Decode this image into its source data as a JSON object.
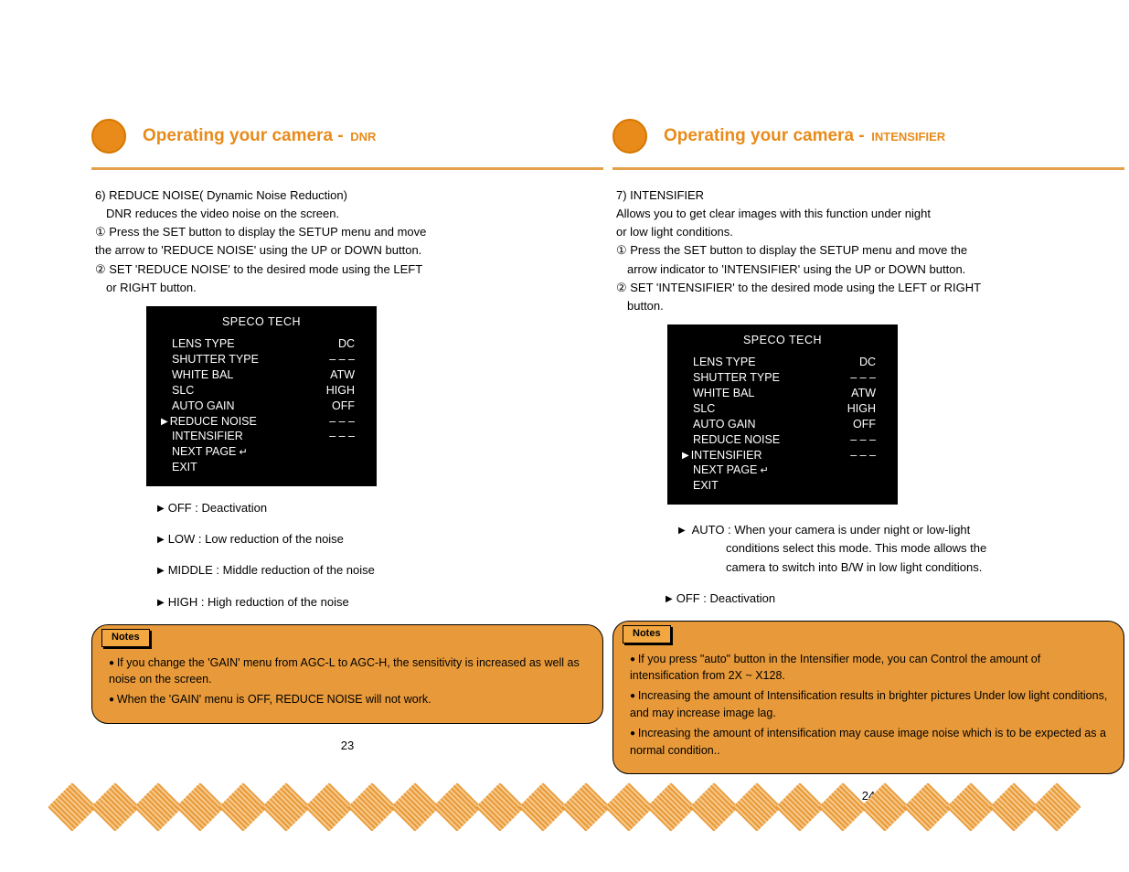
{
  "leftPage": {
    "headerMain": "Operating your camera  -",
    "headerSub": "DNR",
    "intro1": "6) REDUCE NOISE( Dynamic Noise Reduction)",
    "intro2": "DNR reduces the video noise on the screen.",
    "step1": "① Press the SET button to display the SETUP menu and move",
    "step1b": " the arrow to 'REDUCE NOISE' using the UP or DOWN button.",
    "step2": "② SET 'REDUCE NOISE' to the desired mode using the LEFT",
    "step2b": "or RIGHT button.",
    "menuTitle": "SPECO TECH",
    "menu": [
      {
        "label": "LENS TYPE",
        "val": "DC",
        "sel": false
      },
      {
        "label": "SHUTTER TYPE",
        "val": "– – –",
        "sel": false
      },
      {
        "label": "WHITE  BAL",
        "val": "ATW",
        "sel": false
      },
      {
        "label": "SLC",
        "val": "HIGH",
        "sel": false
      },
      {
        "label": "AUTO  GAIN",
        "val": "OFF",
        "sel": false
      },
      {
        "label": "REDUCE NOISE",
        "val": "– – –",
        "sel": true
      },
      {
        "label": "INTENSIFIER",
        "val": "– – –",
        "sel": false
      },
      {
        "label": "NEXT  PAGE",
        "val": "",
        "sel": false,
        "enter": true
      },
      {
        "label": "EXIT",
        "val": "",
        "sel": false
      }
    ],
    "options": [
      "OFF : Deactivation",
      "LOW : Low reduction of the noise",
      "MIDDLE : Middle reduction of the noise",
      "HIGH : High reduction of the noise"
    ],
    "notesLabel": "Notes",
    "notes": [
      "If you change the 'GAIN' menu from AGC-L to AGC-H, the sensitivity is increased as well as noise on the screen.",
      "When the 'GAIN' menu is OFF, REDUCE NOISE will not work."
    ],
    "pageNum": "23"
  },
  "rightPage": {
    "headerMain": "Operating your camera   -",
    "headerSub": "INTENSIFIER",
    "intro1": "7) INTENSIFIER",
    "intro2": "Allows you to get clear images with this function under night",
    "intro2b": "or low light conditions.",
    "step1": "① Press the SET button to display the SETUP menu and move the",
    "step1b": "arrow indicator to 'INTENSIFIER' using the UP or DOWN button.",
    "step2": "② SET 'INTENSIFIER' to the desired mode using the LEFT or RIGHT",
    "step2b": "button.",
    "menuTitle": "SPECO TECH",
    "menu": [
      {
        "label": "LENS TYPE",
        "val": "DC",
        "sel": false
      },
      {
        "label": "SHUTTER TYPE",
        "val": "– – –",
        "sel": false
      },
      {
        "label": "WHITE  BAL",
        "val": "ATW",
        "sel": false
      },
      {
        "label": "SLC",
        "val": "HIGH",
        "sel": false
      },
      {
        "label": "AUTO  GAIN",
        "val": "OFF",
        "sel": false
      },
      {
        "label": "REDUCE NOISE",
        "val": "– – –",
        "sel": false
      },
      {
        "label": "INTENSIFIER",
        "val": "– – –",
        "sel": true
      },
      {
        "label": "NEXT  PAGE",
        "val": "",
        "sel": false,
        "enter": true
      },
      {
        "label": "EXIT",
        "val": "",
        "sel": false
      }
    ],
    "optAuto": "AUTO : When your camera is under night or low-light",
    "optAutoSub1": "conditions select this mode. This mode allows the",
    "optAutoSub2": "camera to switch into B/W in low light conditions.",
    "optOff": "OFF : Deactivation",
    "notesLabel": "Notes",
    "notes": [
      "If you press \"auto\" button in the Intensifier mode, you can Control the amount of intensification from 2X ~ X128.",
      "Increasing the amount of Intensification results in brighter pictures Under low light conditions, and may increase image lag.",
      "Increasing the amount of intensification may cause image noise which is to be expected as a normal condition.."
    ],
    "pageNum": "24"
  }
}
